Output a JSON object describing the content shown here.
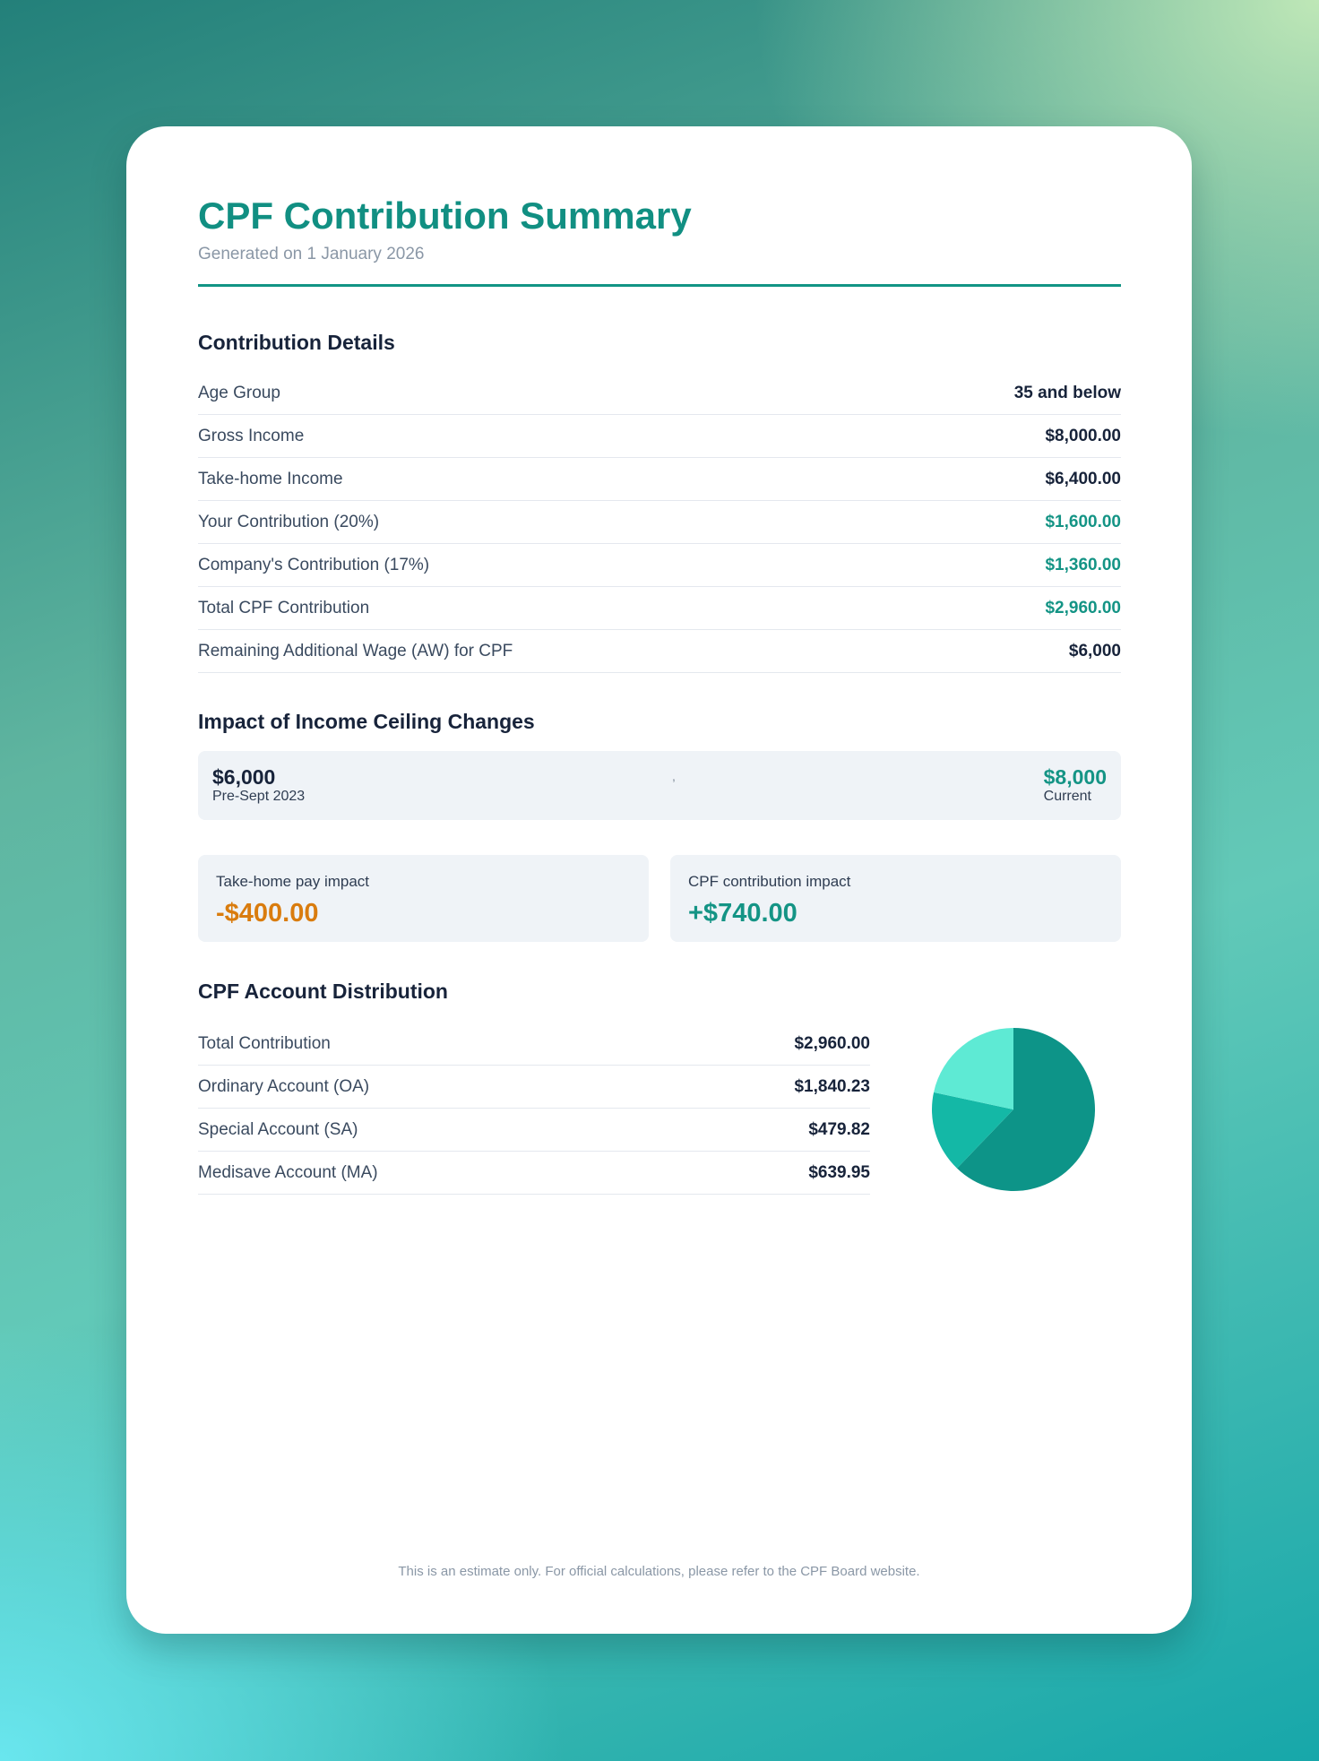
{
  "header": {
    "title": "CPF Contribution Summary",
    "generated": "Generated on 1 January 2026"
  },
  "contribution_details": {
    "heading": "Contribution Details",
    "rows": [
      {
        "label": "Age Group",
        "value": "35 and below"
      },
      {
        "label": "Gross Income",
        "value": "$8,000.00"
      },
      {
        "label": "Take-home Income",
        "value": "$6,400.00"
      },
      {
        "label": "Your Contribution (20%)",
        "value": "$1,600.00"
      },
      {
        "label": "Company's Contribution (17%)",
        "value": "$1,360.00"
      },
      {
        "label": "Total CPF Contribution",
        "value": "$2,960.00"
      },
      {
        "label": "Remaining Additional Wage (AW) for CPF",
        "value": "$6,000"
      }
    ]
  },
  "ceiling": {
    "heading": "Impact of Income Ceiling Changes",
    "previous_amount": "$6,000",
    "previous_label": "Pre-Sept 2023",
    "separator": ",",
    "current_amount": "$8,000",
    "current_label": "Current"
  },
  "impacts": {
    "takehome_label": "Take-home pay impact",
    "takehome_value": "-$400.00",
    "cpf_label": "CPF contribution impact",
    "cpf_value": "+$740.00"
  },
  "distribution": {
    "heading": "CPF Account Distribution",
    "rows": [
      {
        "label": "Total Contribution",
        "value": "$2,960.00"
      },
      {
        "label": "Ordinary Account (OA)",
        "value": "$1,840.23"
      },
      {
        "label": "Special Account (SA)",
        "value": "$479.82"
      },
      {
        "label": "Medisave Account (MA)",
        "value": "$639.95"
      }
    ]
  },
  "chart_data": {
    "type": "pie",
    "categories": [
      "Ordinary Account (OA)",
      "Special Account (SA)",
      "Medisave Account (MA)"
    ],
    "values": [
      1840.23,
      479.82,
      639.95
    ],
    "colors": [
      "#0d9488",
      "#14b8a6",
      "#5eead4"
    ]
  },
  "colors": {
    "accent": "#149485",
    "negative": "#d97c0e",
    "text": "#17233a"
  },
  "footer": {
    "note": "This is an estimate only. For official calculations, please refer to the CPF Board website."
  }
}
